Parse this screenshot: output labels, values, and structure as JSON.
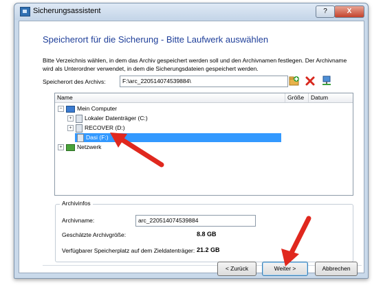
{
  "window": {
    "title": "Sicherungsassistent",
    "help_label": "?",
    "close_label": "X"
  },
  "page": {
    "heading": "Speicherort für die Sicherung - Bitte Laufwerk auswählen",
    "description": "Bitte Verzeichnis wählen, in dem das Archiv gespeichert werden soll und den Archivnamen festlegen. Der Archivname wird als Unterordner verwendet, in dem die Sicherungsdateien gespeichert werden."
  },
  "path": {
    "label": "Speicherort des Archivs:",
    "value": "F:\\arc_220514074539884\\"
  },
  "icons": {
    "new_folder": "folder-add-icon",
    "delete": "delete-x-icon",
    "network": "network-drive-icon"
  },
  "tree": {
    "columns": [
      "Name",
      "Größe",
      "Datum"
    ],
    "items": [
      {
        "label": "Mein Computer",
        "expander": "−",
        "icon": "computer-icon"
      },
      {
        "label": "Lokaler Datenträger (C:)",
        "expander": "+",
        "icon": "drive-icon"
      },
      {
        "label": "RECOVER (D:)",
        "expander": "+",
        "icon": "drive-icon"
      },
      {
        "label": "Dasi (F:)",
        "expander": "",
        "icon": "drive-icon",
        "selected": true
      },
      {
        "label": "Netzwerk",
        "expander": "+",
        "icon": "network-icon"
      }
    ]
  },
  "archive": {
    "group_label": "Archivinfos",
    "name_label": "Archivname:",
    "name_value": "arc_220514074539884",
    "size_label": "Geschätzte Archivgröße:",
    "size_value": "8.8 GB",
    "space_label": "Verfügbarer Speicherplatz auf dem Zieldatenträger:",
    "space_value": "21.2 GB"
  },
  "buttons": {
    "back": "< Zurück",
    "next": "Weiter >",
    "cancel": "Abbrechen"
  },
  "colors": {
    "heading": "#1f3f9a",
    "selection": "#3399ff",
    "annotation_arrow": "#e0281e"
  }
}
